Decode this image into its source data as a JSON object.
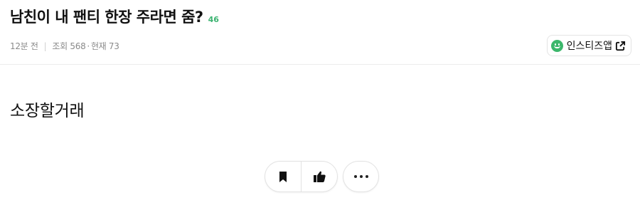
{
  "post": {
    "title": "남친이 내 팬티 한장 주라면 줌?",
    "comment_count": "46",
    "time_ago": "12분 전",
    "views": "조회 568",
    "current": "현재 73",
    "meta_dot": "·",
    "body": "소장할거래"
  },
  "app_button": {
    "label": "인스티즈앱",
    "icon": "smile-logo-icon",
    "accent": "#3cb76b"
  },
  "actions": {
    "bookmark_icon": "bookmark-icon",
    "like_icon": "thumbs-up-icon",
    "more_icon": "more-dots-icon"
  },
  "colors": {
    "accent_green": "#3cb371",
    "meta_gray": "#8a8a8a",
    "border": "#e2e2e2"
  }
}
